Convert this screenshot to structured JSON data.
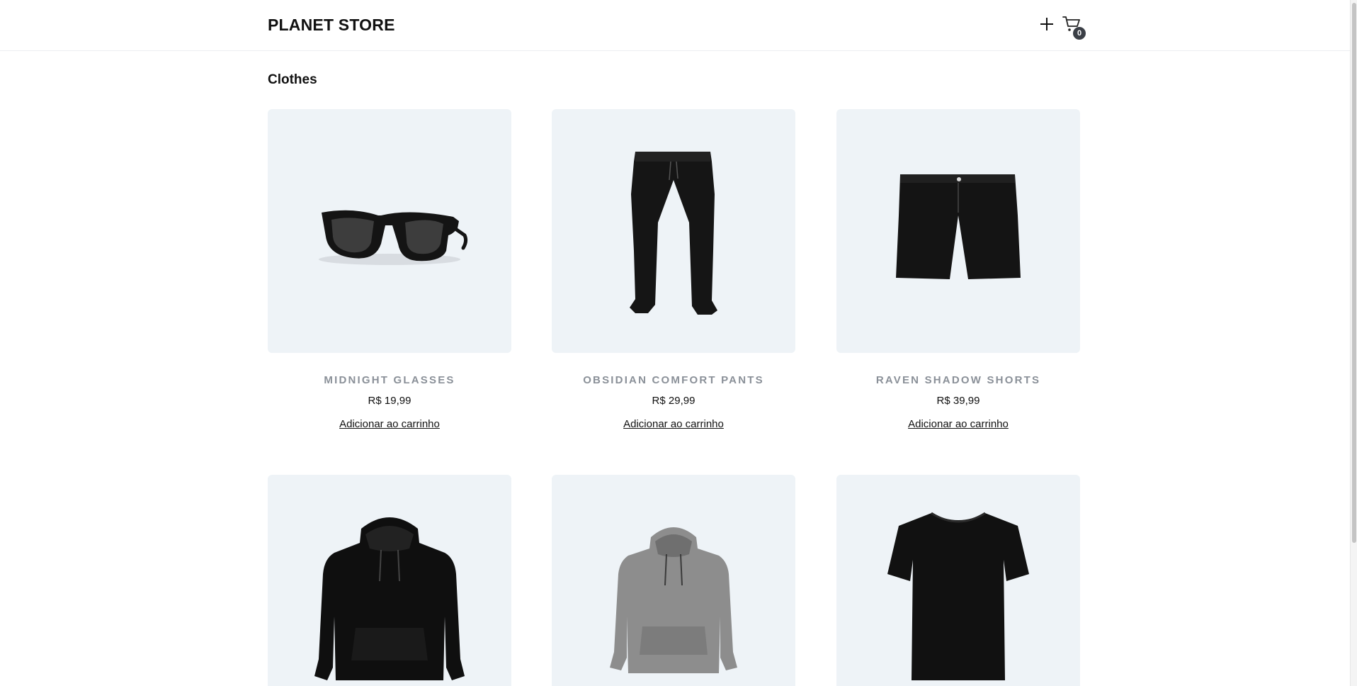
{
  "header": {
    "brand": "PLANET STORE",
    "add_icon": "plus-icon",
    "cart_icon": "cart-icon",
    "cart_count": "0"
  },
  "section": {
    "title": "Clothes"
  },
  "products": [
    {
      "name": "MIDNIGHT GLASSES",
      "price": "R$ 19,99",
      "action": "Adicionar ao carrinho",
      "image": "sunglasses"
    },
    {
      "name": "OBSIDIAN COMFORT PANTS",
      "price": "R$ 29,99",
      "action": "Adicionar ao carrinho",
      "image": "pants"
    },
    {
      "name": "RAVEN SHADOW SHORTS",
      "price": "R$ 39,99",
      "action": "Adicionar ao carrinho",
      "image": "shorts"
    },
    {
      "name": "",
      "price": "",
      "action": "",
      "image": "black-hoodie"
    },
    {
      "name": "",
      "price": "",
      "action": "",
      "image": "gray-hoodie"
    },
    {
      "name": "",
      "price": "",
      "action": "",
      "image": "black-tshirt"
    }
  ],
  "colors": {
    "card_background": "#eef3f7",
    "product_name": "#8a9098",
    "badge": "#3b3f46"
  }
}
